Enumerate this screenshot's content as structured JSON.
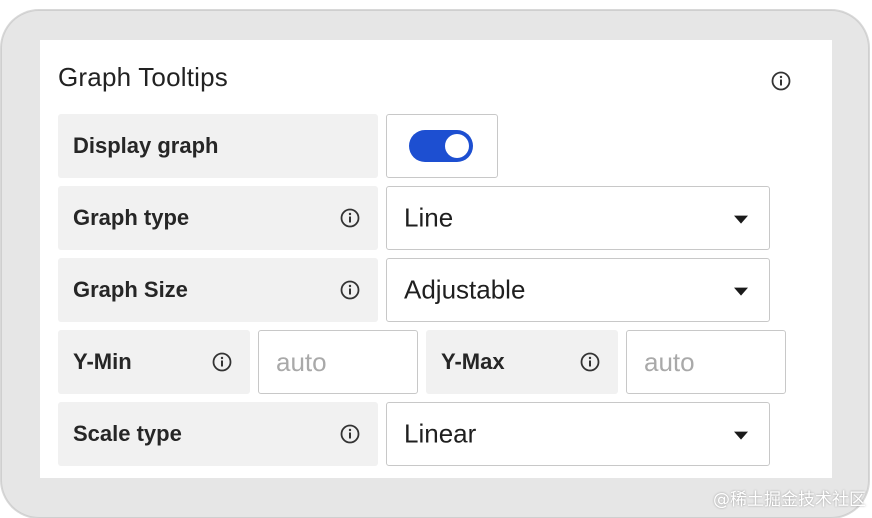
{
  "panel": {
    "title": "Graph Tooltips"
  },
  "rows": {
    "display_graph": {
      "label": "Display graph",
      "toggle_on": true
    },
    "graph_type": {
      "label": "Graph type",
      "value": "Line"
    },
    "graph_size": {
      "label": "Graph Size",
      "value": "Adjustable"
    },
    "y_min": {
      "label": "Y-Min",
      "placeholder": "auto"
    },
    "y_max": {
      "label": "Y-Max",
      "placeholder": "auto"
    },
    "scale_type": {
      "label": "Scale type",
      "value": "Linear"
    }
  },
  "icons": {
    "info": "info-circle-icon",
    "dropdown": "caret-down-icon"
  },
  "colors": {
    "toggle_on": "#1d4fd1",
    "label_bg": "#f1f1f1",
    "border": "#c8c8c8",
    "placeholder": "#a9a9a9"
  },
  "watermark": "@稀土掘金技术社区"
}
